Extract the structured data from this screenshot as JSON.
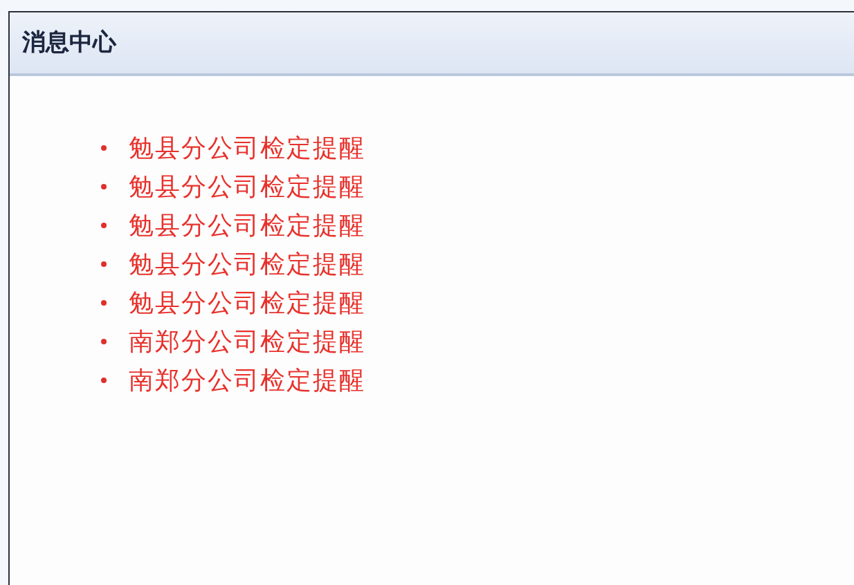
{
  "panel": {
    "title": "消息中心",
    "messages": [
      {
        "text": "勉县分公司检定提醒"
      },
      {
        "text": "勉县分公司检定提醒"
      },
      {
        "text": "勉县分公司检定提醒"
      },
      {
        "text": "勉县分公司检定提醒"
      },
      {
        "text": "勉县分公司检定提醒"
      },
      {
        "text": "南郑分公司检定提醒"
      },
      {
        "text": "南郑分公司检定提醒"
      }
    ]
  }
}
